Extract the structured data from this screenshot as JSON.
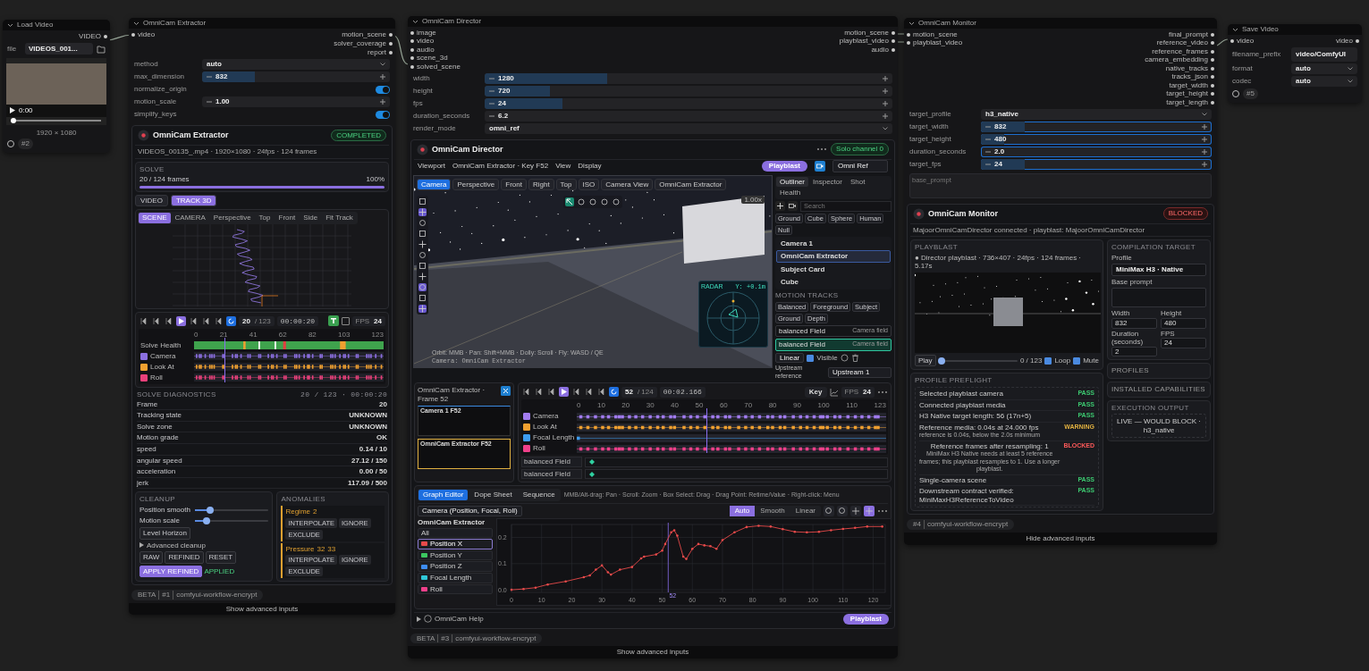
{
  "load_video": {
    "title": "Load Video",
    "output": "VIDEO",
    "file_label": "file",
    "file_value": "VIDEOS_001...",
    "time": "0:00",
    "level": 0,
    "resolution": "1920 × 1080",
    "node_id": "#2"
  },
  "extractor": {
    "title": "OmniCam Extractor",
    "inputs": [
      "video"
    ],
    "outputs": [
      "motion_scene",
      "solver_coverage",
      "report"
    ],
    "widgets": [
      {
        "kind": "combo",
        "label": "method",
        "value": "auto"
      },
      {
        "kind": "number",
        "label": "max_dimension",
        "value": "832",
        "level": 0.28
      },
      {
        "kind": "toggle",
        "label": "normalize_origin",
        "on": true
      },
      {
        "kind": "number",
        "label": "motion_scale",
        "value": "1.00"
      },
      {
        "kind": "toggle",
        "label": "simplify_keys",
        "on": true
      }
    ],
    "panel": {
      "title": "OmniCam Extractor",
      "status": "COMPLETED",
      "source": "VIDEOS_00135_.mp4 · 1920×1080 · 24fps · 124 frames",
      "solve": {
        "label": "SOLVE",
        "frames": "20 / 124 frames",
        "percent": "100%",
        "level": 1
      },
      "modes": [
        {
          "label": "VIDEO",
          "selected": false
        },
        {
          "label": "TRACK 3D",
          "selected": true
        }
      ],
      "views": [
        {
          "label": "SCENE",
          "selected": true
        },
        {
          "label": "CAMERA",
          "selected": false
        },
        {
          "label": "Perspective",
          "selected": false
        },
        {
          "label": "Top",
          "selected": false
        },
        {
          "label": "Front",
          "selected": false
        },
        {
          "label": "Side",
          "selected": false
        },
        {
          "label": "Fit Track",
          "selected": false
        }
      ],
      "transport": {
        "frame": "20",
        "total": "/ 123",
        "timecode": "00:00:20",
        "track_keys": true,
        "lock": {
          "checked": false
        },
        "fps_label": "FPS",
        "fps": "24"
      },
      "ruler": [
        "0",
        "21",
        "41",
        "62",
        "82",
        "103",
        "123"
      ],
      "health_label": "Solve Health",
      "tracks": [
        {
          "label": "Camera",
          "checked": true,
          "color": "#8b6fe0"
        },
        {
          "label": "Look At",
          "checked": true,
          "color": "#f0a030"
        },
        {
          "label": "Roll",
          "checked": true,
          "color": "#e8407a"
        }
      ],
      "diagnostics": {
        "title": "SOLVE DIAGNOSTICS",
        "position": "20 / 123 · 00:00:20",
        "rows": [
          {
            "label": "Frame",
            "value": "20"
          },
          {
            "label": "Tracking state",
            "value": "UNKNOWN"
          },
          {
            "label": "Solve zone",
            "value": "UNKNOWN"
          },
          {
            "label": "Motion grade",
            "value": "OK"
          },
          {
            "label": "speed",
            "value": "0.14 / 10"
          },
          {
            "label": "angular speed",
            "value": "27.12 / 150"
          },
          {
            "label": "acceleration",
            "value": "0.00 / 50"
          },
          {
            "label": "jerk",
            "value": "117.09 / 500"
          }
        ]
      },
      "cleanup": {
        "title": "CLEANUP",
        "sliders": [
          {
            "label": "Position smooth",
            "level": 0.17
          },
          {
            "label": "Motion scale",
            "level": 0.12
          }
        ],
        "level_button": "Level Horizon",
        "advanced": "Advanced cleanup",
        "buttons": [
          {
            "label": "RAW",
            "kind": "plain"
          },
          {
            "label": "REFINED",
            "kind": "plain"
          },
          {
            "label": "RESET",
            "kind": "plain"
          },
          {
            "label": "APPLY REFINED",
            "kind": "primary"
          }
        ],
        "applied": "APPLIED"
      },
      "anomalies": {
        "title": "ANOMALIES",
        "items": [
          {
            "name": "Regime",
            "frames": [
              "2"
            ],
            "actions": [
              "INTERPOLATE",
              "IGNORE",
              "EXCLUDE"
            ]
          },
          {
            "name": "Pressure",
            "frames": [
              "32",
              "33"
            ],
            "actions": [
              "INTERPOLATE",
              "IGNORE",
              "EXCLUDE"
            ]
          }
        ]
      }
    },
    "footer": {
      "badges": [
        "BETA",
        "#1",
        "comfyui-workflow-encrypt"
      ],
      "advanced": "Show advanced inputs"
    }
  },
  "director": {
    "title": "OmniCam Director",
    "inputs": [
      "image",
      "video",
      "audio",
      "scene_3d",
      "solved_scene"
    ],
    "outputs": [
      "motion_scene",
      "playblast_video",
      "audio"
    ],
    "widgets": [
      {
        "kind": "number",
        "label": "width",
        "value": "1280",
        "level": 0.3
      },
      {
        "kind": "number",
        "label": "height",
        "value": "720",
        "level": 0.16
      },
      {
        "kind": "number",
        "label": "fps",
        "value": "24",
        "level": 0.19
      },
      {
        "kind": "number",
        "label": "duration_seconds",
        "value": "6.2"
      },
      {
        "kind": "combo",
        "label": "render_mode",
        "value": "omni_ref"
      }
    ],
    "panel": {
      "title": "OmniCam Director",
      "status": "Solo channel 0",
      "toolbar": [
        "Viewport",
        "OmniCam Extractor · Key F52",
        "View",
        "Display"
      ],
      "playblast": "Playblast",
      "camera_select": "Omni Ref",
      "view_tabs": [
        {
          "label": "Camera",
          "selected": true
        },
        {
          "label": "Perspective",
          "selected": false
        },
        {
          "label": "Front",
          "selected": false
        },
        {
          "label": "Right",
          "selected": false
        },
        {
          "label": "Top",
          "selected": false
        },
        {
          "label": "ISO",
          "selected": false
        },
        {
          "label": "Camera View",
          "selected": false
        },
        {
          "label": "OmniCam Extractor",
          "selected": false
        }
      ],
      "zoom": "1.00x",
      "camera_caption": "Camera: OmniCam Extractor",
      "hint": "Orbit: MMB · Pan: Shift+MMB · Dolly: Scroll · Fly: WASD / QE",
      "radar": {
        "label": "RADAR",
        "reading": "Y: +0.1m"
      },
      "side_tabs": [
        {
          "label": "Outliner",
          "selected": true
        },
        {
          "label": "Inspector",
          "selected": false
        },
        {
          "label": "Shot",
          "selected": false
        },
        {
          "label": "Health",
          "selected": false
        }
      ],
      "search": {
        "placeholder": "Search"
      },
      "add_buttons": [
        "Ground",
        "Cube",
        "Sphere",
        "Human",
        "Null"
      ],
      "outliner": [
        {
          "name": "Camera 1",
          "selected": false
        },
        {
          "name": "OmniCam Extractor",
          "selected": true
        },
        {
          "name": "Subject Card",
          "selected": false
        },
        {
          "name": "Cube",
          "selected": false
        }
      ],
      "motion_title": "MOTION TRACKS",
      "motion_presets": [
        "Balanced",
        "Foreground",
        "Subject",
        "Ground",
        "Depth"
      ],
      "motion_tracks": [
        {
          "name": "balanced Field",
          "note": "Camera field",
          "selected": false
        },
        {
          "name": "balanced Field",
          "note": "Camera field",
          "selected": true
        }
      ],
      "interp": "Linear",
      "visible_label": "Visible",
      "visible": true,
      "upstream_label": "Upstream reference",
      "upstream": "Upstream 1",
      "filmstrip": {
        "title": "OmniCam Extractor · Frame 52",
        "shots": [
          {
            "name": "Camera 1 F52",
            "selected": false
          },
          {
            "name": "OmniCam Extractor F52",
            "selected": true
          }
        ]
      },
      "transport": {
        "frame": "52",
        "total": "/ 124",
        "timecode": "00:02.166",
        "key": "Key",
        "fps_label": "FPS",
        "fps": "24"
      },
      "ruler": [
        "0",
        "10",
        "20",
        "30",
        "40",
        "50",
        "60",
        "70",
        "80",
        "90",
        "100",
        "110",
        "123"
      ],
      "tracks": [
        {
          "label": "Camera",
          "checked": true,
          "color": "#a27cf0"
        },
        {
          "label": "Look At",
          "checked": true,
          "color": "#f0a030"
        },
        {
          "label": "Focal Length",
          "checked": true,
          "color": "#3d9cf0"
        },
        {
          "label": "Roll",
          "checked": true,
          "color": "#f0408a"
        }
      ],
      "field_tracks": [
        "balanced Field",
        "balanced Field"
      ],
      "editor_tabs": [
        {
          "label": "Graph Editor",
          "selected": true
        },
        {
          "label": "Dope Sheet",
          "selected": false
        },
        {
          "label": "Sequence",
          "selected": false
        }
      ],
      "editor_hint": "MMB/Alt-drag: Pan · Scroll: Zoom · Box Select: Drag · Drag Point: Retime/Value · Right-click: Menu",
      "channel_select": "Camera (Position, Focal, Roll)",
      "interp_modes": [
        {
          "label": "Auto",
          "selected": true
        },
        {
          "label": "Smooth",
          "selected": false
        },
        {
          "label": "Linear",
          "selected": false
        }
      ],
      "channels_title": "OmniCam Extractor",
      "channels": [
        {
          "label": "All",
          "selected": false
        },
        {
          "label": "Position X",
          "selected": true,
          "color": "#e84a4a"
        },
        {
          "label": "Position Y",
          "selected": false,
          "color": "#3cc860"
        },
        {
          "label": "Position Z",
          "selected": false,
          "color": "#3d8cf0"
        },
        {
          "label": "Focal Length",
          "selected": false,
          "color": "#2fc7d8"
        },
        {
          "label": "Roll",
          "selected": false,
          "color": "#f0408a"
        }
      ],
      "chart_data": {
        "type": "line",
        "grid": true,
        "x": [
          0,
          4,
          8,
          12,
          18,
          24,
          26,
          28,
          30,
          32,
          33,
          36,
          40,
          43,
          44,
          48,
          50,
          51,
          53,
          54,
          55,
          57,
          58,
          60,
          62,
          64,
          66,
          68,
          70,
          74,
          78,
          82,
          86,
          90,
          94,
          98,
          102,
          106,
          110,
          114,
          118,
          123
        ],
        "series": [
          {
            "color": "#e84a4a",
            "values": [
              0.0,
              0.003,
              0.008,
              0.02,
              0.032,
              0.048,
              0.055,
              0.077,
              0.093,
              0.067,
              0.058,
              0.077,
              0.087,
              0.12,
              0.127,
              0.135,
              0.15,
              0.175,
              0.22,
              0.228,
              0.207,
              0.127,
              0.118,
              0.157,
              0.175,
              0.17,
              0.167,
              0.157,
              0.19,
              0.22,
              0.24,
              0.245,
              0.242,
              0.232,
              0.222,
              0.22,
              0.222,
              0.228,
              0.233,
              0.237,
              0.242,
              0.242
            ]
          }
        ],
        "xlim": [
          0,
          124
        ],
        "ylim": [
          -0.01,
          0.25
        ],
        "xticks": [
          0,
          10,
          20,
          30,
          40,
          50,
          60,
          70,
          80,
          90,
          100,
          110,
          120
        ],
        "yticks": [
          {
            "value": 0,
            "label": "0.0"
          },
          {
            "value": 0.1,
            "label": "0.1"
          },
          {
            "value": 0.2,
            "label": "0.2"
          }
        ],
        "ref_lines": [
          {
            "axis": "x",
            "value": 52
          }
        ],
        "annotations": [
          "52"
        ]
      },
      "help": "OmniCam Help",
      "help_playblast": "Playblast"
    },
    "footer": {
      "badges": [
        "BETA",
        "#3",
        "comfyui-workflow-encrypt"
      ],
      "advanced": "Show advanced inputs"
    }
  },
  "monitor": {
    "title": "OmniCam Monitor",
    "inputs": [
      "motion_scene",
      "playblast_video"
    ],
    "outputs": [
      "final_prompt",
      "reference_video",
      "reference_frames",
      "camera_embedding",
      "native_tracks",
      "tracks_json",
      "target_width",
      "target_height",
      "target_length"
    ],
    "widgets": [
      {
        "kind": "combo",
        "label": "target_profile",
        "value": "h3_native"
      },
      {
        "kind": "number",
        "label": "target_width",
        "value": "832",
        "level": 0.19
      },
      {
        "kind": "number",
        "label": "target_height",
        "value": "480",
        "level": 0.1
      },
      {
        "kind": "number",
        "label": "duration_seconds",
        "value": "2.0"
      },
      {
        "kind": "number",
        "label": "target_fps",
        "value": "24",
        "level": 0.19
      }
    ],
    "prompt": {
      "placeholder": "base_prompt"
    },
    "panel": {
      "title": "OmniCam Monitor",
      "status": "BLOCKED",
      "connection": "MajoorOmniCamDirector connected · playblast: MajoorOmniCamDirector",
      "playblast": {
        "title": "PLAYBLAST",
        "info": "● Director playblast · 736×407 · 24fps · 124 frames · 5.17s",
        "play": "Play",
        "level": 0,
        "position": "0 / 123",
        "loop": {
          "label": "Loop",
          "checked": true
        },
        "mute": {
          "label": "Mute",
          "checked": true
        }
      },
      "preflight": {
        "title": "PROFILE PREFLIGHT",
        "checks": [
          {
            "text": "Selected playblast camera",
            "status": "PASS",
            "kind": "pass"
          },
          {
            "text": "Connected playblast media",
            "status": "PASS",
            "kind": "pass"
          },
          {
            "text": "H3 Native target length: 56 (17n+5)",
            "status": "PASS",
            "kind": "pass"
          },
          {
            "text": "Reference media: 0.04s at 24.000 fps",
            "detail": "reference is 0.04s, below the 2.0s minimum",
            "status": "WARNING",
            "kind": "warning"
          },
          {
            "text": "Reference frames after resampling: 1",
            "detail": "MiniMax H3 Native needs at least 5 reference frames; this playblast resamples to 1. Use a longer playblast.",
            "status": "BLOCKED",
            "kind": "blocked"
          },
          {
            "text": "Single-camera scene",
            "status": "PASS",
            "kind": "pass"
          },
          {
            "text": "Downstream contract verified: MiniMaxH3ReferenceToVideo",
            "status": "PASS",
            "kind": "pass"
          }
        ]
      },
      "target": {
        "title": "COMPILATION TARGET",
        "profile_label": "Profile",
        "profile": "MiniMax H3 · Native",
        "prompt_label": "Base prompt",
        "fields": [
          {
            "label": "Width",
            "value": "832"
          },
          {
            "label": "Height",
            "value": "480"
          },
          {
            "label": "Duration (seconds)",
            "value": "2"
          },
          {
            "label": "FPS",
            "value": "24"
          }
        ]
      },
      "sections": [
        "PROFILES",
        "INSTALLED CAPABILITIES"
      ],
      "execution": {
        "title": "EXECUTION OUTPUT",
        "value": "LIVE — WOULD BLOCK · h3_native"
      }
    },
    "footer": {
      "badges": [
        "#4",
        "comfyui-workflow-encrypt"
      ],
      "advanced": "Hide advanced inputs"
    }
  },
  "save_video": {
    "title": "Save Video",
    "input": "video",
    "output": "video",
    "widgets": [
      {
        "kind": "text",
        "label": "filename_prefix",
        "value": "video/ComfyUI"
      },
      {
        "kind": "combo",
        "label": "format",
        "value": "auto"
      },
      {
        "kind": "combo",
        "label": "codec",
        "value": "auto"
      }
    ],
    "node_id": "#5"
  }
}
